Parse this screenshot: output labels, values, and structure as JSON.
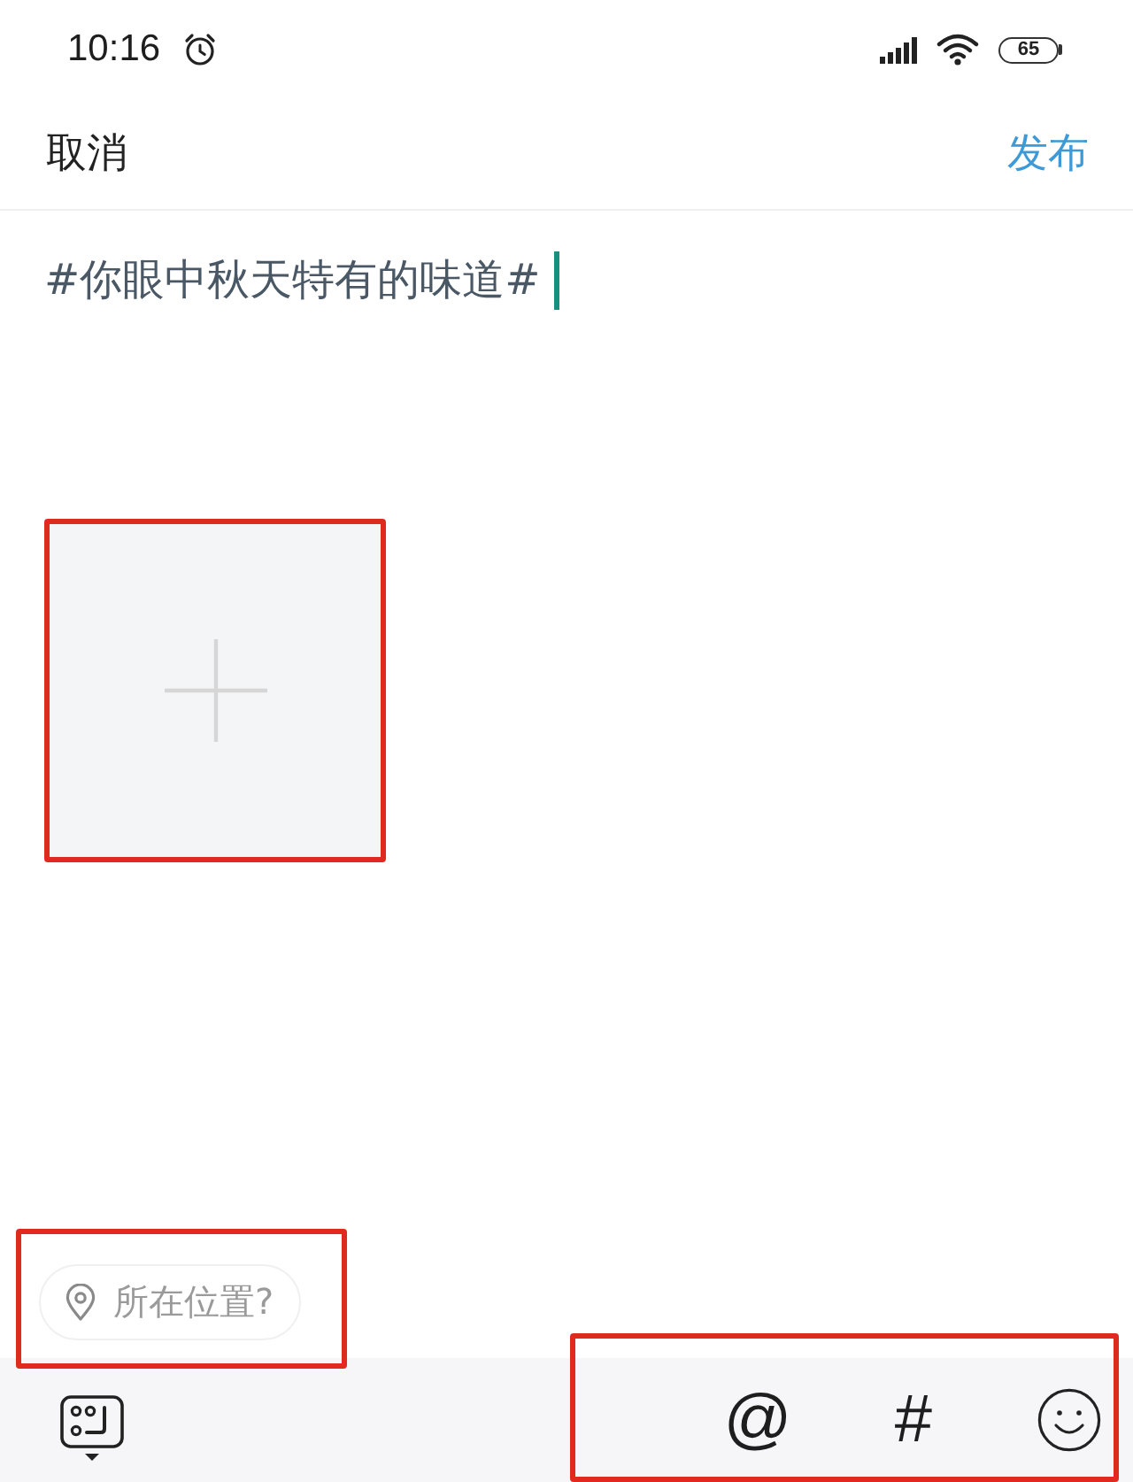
{
  "status_bar": {
    "time": "10:16",
    "battery": "65"
  },
  "header": {
    "cancel": "取消",
    "publish": "发布"
  },
  "editor": {
    "text": "#你眼中秋天特有的味道#",
    "cursor": true
  },
  "photo_picker": {
    "highlighted": true
  },
  "location": {
    "label": "所在位置?",
    "highlighted": true
  },
  "toolbar": {
    "insert_tools": {
      "highlighted": true,
      "items": [
        {
          "kind": "mention",
          "label": "@"
        },
        {
          "kind": "topic",
          "label": "#"
        },
        {
          "kind": "emoji"
        }
      ]
    }
  }
}
